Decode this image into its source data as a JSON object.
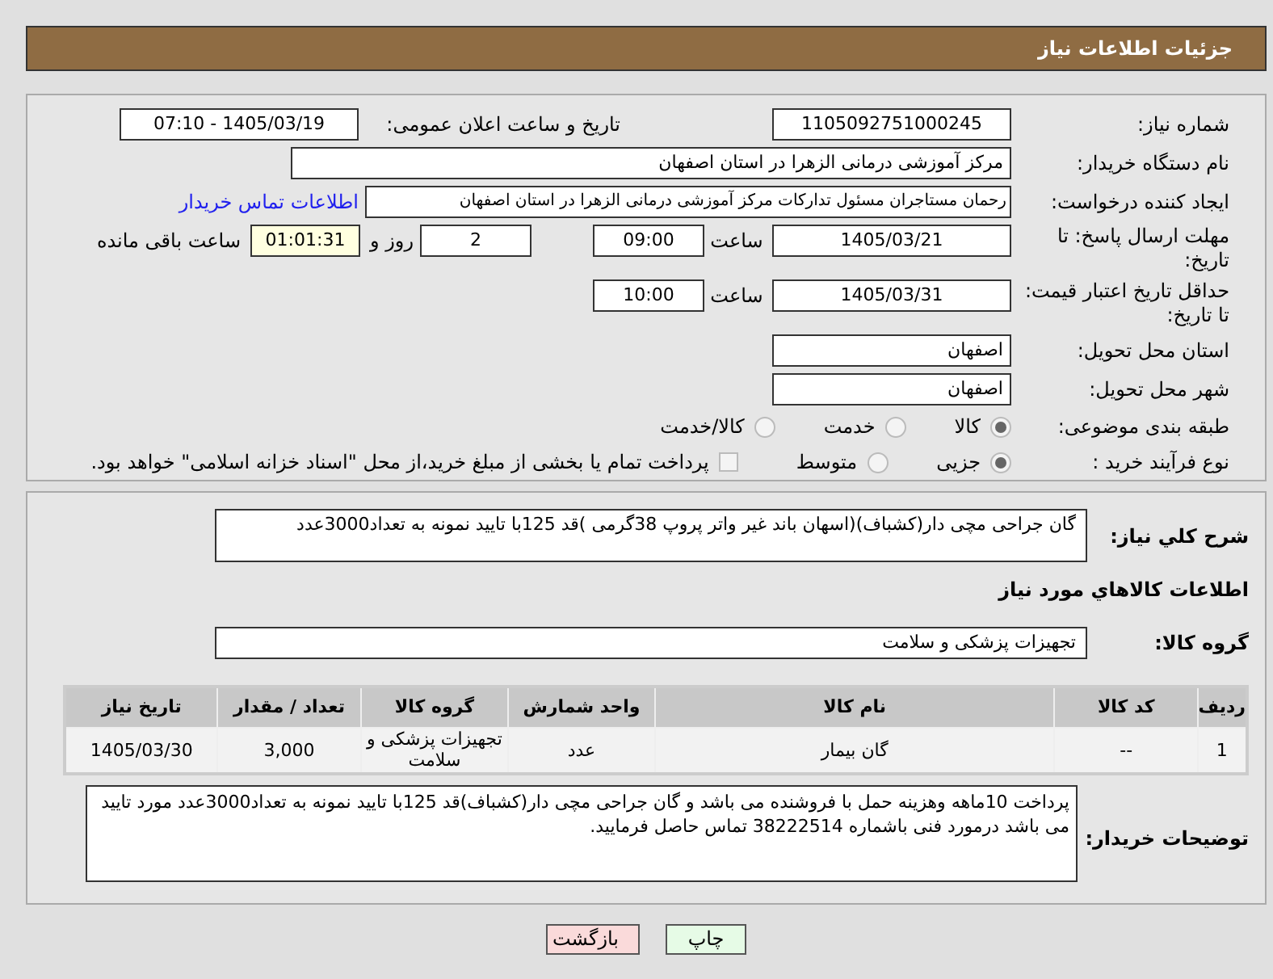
{
  "header": {
    "title": "جزئیات اطلاعات نیاز"
  },
  "need_number": {
    "label": "شماره نیاز:",
    "value": "1105092751000245"
  },
  "announce": {
    "label": "تاریخ و ساعت اعلان عمومی:",
    "value": "1405/03/19 - 07:10"
  },
  "buyer_org": {
    "label": "نام دستگاه خریدار:",
    "value": "مرکز آموزشی درمانی الزهرا در استان اصفهان"
  },
  "requester": {
    "label": "ایجاد کننده درخواست:",
    "value": "رحمان مستاجران مسئول تدارکات مرکز آموزشی درمانی الزهرا در استان اصفهان",
    "link": "اطلاعات تماس خریدار"
  },
  "deadline": {
    "label": "مهلت ارسال پاسخ: تا تاریخ:",
    "date": "1405/03/21",
    "time_label": "ساعت",
    "time": "09:00",
    "days": "2",
    "days_label": "روز و",
    "remaining": "01:01:31",
    "remaining_label": "ساعت باقی مانده"
  },
  "validity": {
    "label": "حداقل تاریخ اعتبار قیمت: تا تاریخ:",
    "date": "1405/03/31",
    "time_label": "ساعت",
    "time": "10:00"
  },
  "province": {
    "label": "استان محل تحویل:",
    "value": "اصفهان"
  },
  "city": {
    "label": "شهر محل تحویل:",
    "value": "اصفهان"
  },
  "category": {
    "label": "طبقه بندی موضوعی:",
    "options": [
      {
        "label": "کالا",
        "selected": true
      },
      {
        "label": "خدمت",
        "selected": false
      },
      {
        "label": "کالا/خدمت",
        "selected": false
      }
    ]
  },
  "purchase_type": {
    "label": "نوع فرآیند خرید :",
    "options": [
      {
        "label": "جزیی",
        "selected": true
      },
      {
        "label": "متوسط",
        "selected": false
      }
    ],
    "treasury": {
      "label": "پرداخت تمام یا بخشی از مبلغ خرید،از محل \"اسناد خزانه اسلامی\" خواهد بود.",
      "checked": false
    }
  },
  "summary": {
    "label": "شرح کلي نياز:",
    "value": "گان جراحی مچی دار(کشباف)(اسهان باند غیر واتر پروپ 38گرمی )قد 125با تایید نمونه به تعداد3000عدد"
  },
  "goods_heading": "اطلاعات کالاهاي مورد نياز",
  "goods_group": {
    "label": "گروه کالا:",
    "value": "تجهیزات پزشکی و سلامت"
  },
  "table": {
    "columns": [
      "ردیف",
      "کد کالا",
      "نام کالا",
      "واحد شمارش",
      "گروه کالا",
      "تعداد / مقدار",
      "تاریخ نیاز"
    ],
    "rows": [
      [
        "1",
        "--",
        "گان بیمار",
        "عدد",
        "تجهیزات پزشکی و سلامت",
        "3,000",
        "1405/03/30"
      ]
    ]
  },
  "buyer_notes": {
    "label": "توضیحات خریدار:",
    "value": "پرداخت 10ماهه وهزینه حمل با فروشنده می باشد و گان جراحی مچی دار(کشباف)قد 125با تایید نمونه به تعداد3000عدد مورد تایید می باشد درمورد فنی باشماره 38222514 تماس حاصل فرمایید."
  },
  "buttons": [
    {
      "kind": "print",
      "label": "چاپ"
    },
    {
      "kind": "back",
      "label": "بازگشت"
    }
  ]
}
